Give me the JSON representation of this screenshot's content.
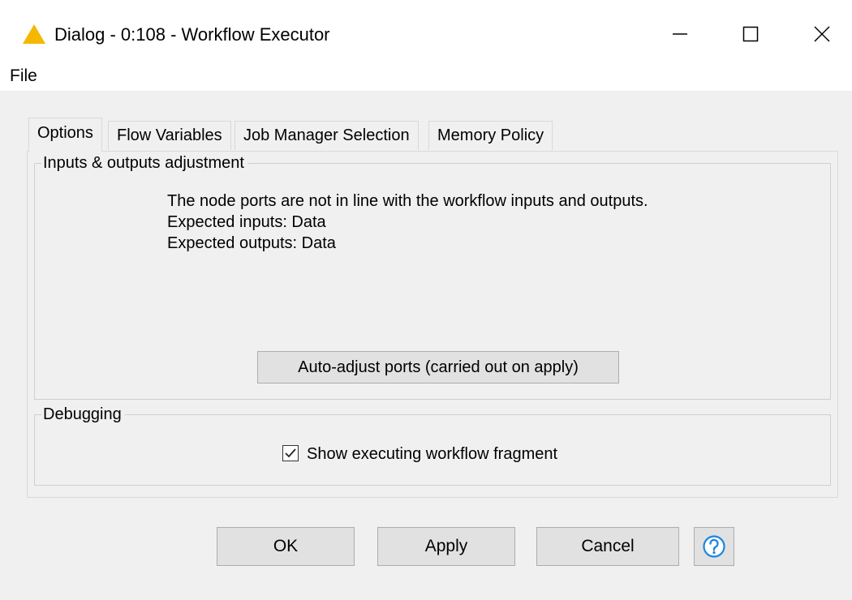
{
  "window": {
    "title": "Dialog - 0:108 - Workflow Executor",
    "icon": "warning-triangle-icon",
    "controls": [
      "minimize-icon",
      "maximize-icon",
      "close-icon"
    ]
  },
  "menu": {
    "file_label": "File"
  },
  "tabs": [
    {
      "label": "Options",
      "active": true
    },
    {
      "label": "Flow Variables",
      "active": false
    },
    {
      "label": "Job Manager Selection",
      "active": false
    },
    {
      "label": "Memory Policy",
      "active": false
    }
  ],
  "inputs_outputs": {
    "legend": "Inputs & outputs adjustment",
    "message": "The node ports are not in line with the workflow inputs and outputs.",
    "expected_inputs": "Expected inputs: Data",
    "expected_outputs": "Expected outputs: Data",
    "auto_adjust_label": "Auto-adjust ports (carried out on apply)"
  },
  "debugging": {
    "legend": "Debugging",
    "show_fragment_label": "Show executing workflow fragment",
    "show_fragment_checked": true
  },
  "buttons": {
    "ok_label": "OK",
    "apply_label": "Apply",
    "cancel_label": "Cancel",
    "help_icon": "help-icon"
  },
  "colors": {
    "warning_yellow": "#f5b800",
    "help_blue": "#1a86e0"
  }
}
